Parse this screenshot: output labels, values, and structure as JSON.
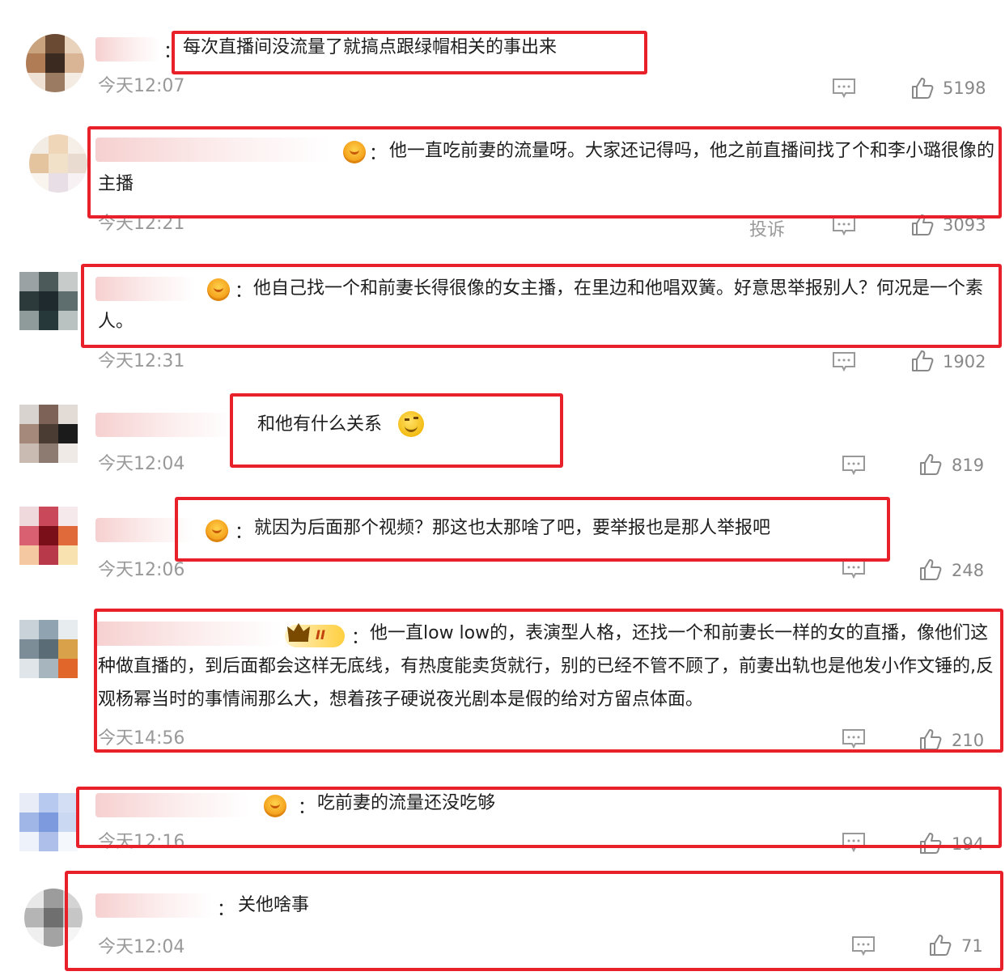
{
  "colors": {
    "highlight_border": "#e8202a",
    "meta_text": "#999999",
    "body_text": "#1e1e1e"
  },
  "icons": {
    "reply": "comment-bubble",
    "like": "thumbs-up",
    "badge": "fan-badge"
  },
  "comments": [
    {
      "colon": "：",
      "text": "每次直播间没流量了就搞点跟绿帽相关的事出来",
      "time": "今天12:07",
      "likes": "5198"
    },
    {
      "colon": "：",
      "text": "他一直吃前妻的流量呀。大家还记得吗，他之前直播间找了个和李小璐很像的主播",
      "time": "今天12:21",
      "report": "投诉",
      "likes": "3093"
    },
    {
      "colon": "：",
      "text": "他自己找一个和前妻长得很像的女主播，在里边和他唱双簧。好意思举报别人？何况是一个素人。",
      "time": "今天12:31",
      "likes": "1902"
    },
    {
      "colon": "",
      "text": "和他有什么关系",
      "time": "今天12:04",
      "likes": "819"
    },
    {
      "colon": "：",
      "text": "就因为后面那个视频？那这也太那啥了吧，要举报也是那人举报吧",
      "time": "今天12:06",
      "likes": "248"
    },
    {
      "colon": "：",
      "text": "他一直low low的，表演型人格，还找一个和前妻长一样的女的直播，像他们这种做直播的，到后面都会这样无底线，有热度能卖货就行，别的已经不管不顾了，前妻出轨也是他发小作文锤的,反观杨幂当时的事情闹那么大，想着孩子硬说夜光剧本是假的给对方留点体面。",
      "time": "今天14:56",
      "likes": "210",
      "badge_level": "II"
    },
    {
      "colon": "：",
      "text": "吃前妻的流量还没吃够",
      "time": "今天12:16",
      "likes": "194"
    },
    {
      "colon": "：",
      "text": "关他啥事",
      "time": "今天12:04",
      "likes": "71"
    }
  ]
}
